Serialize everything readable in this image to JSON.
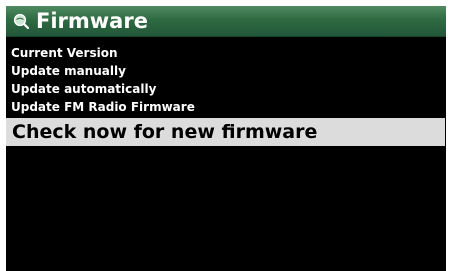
{
  "header": {
    "title": "Firmware",
    "icon": "magnifier-globe-icon"
  },
  "menu": {
    "items": [
      {
        "label": "Current Version"
      },
      {
        "label": "Update manually"
      },
      {
        "label": "Update automatically"
      },
      {
        "label": "Update FM Radio Firmware"
      },
      {
        "label": "Check now for new firmware",
        "selected": true
      }
    ]
  },
  "colors": {
    "header_bg": "#2f6b42",
    "screen_bg": "#000000",
    "selected_bg": "#dcdcdc"
  }
}
